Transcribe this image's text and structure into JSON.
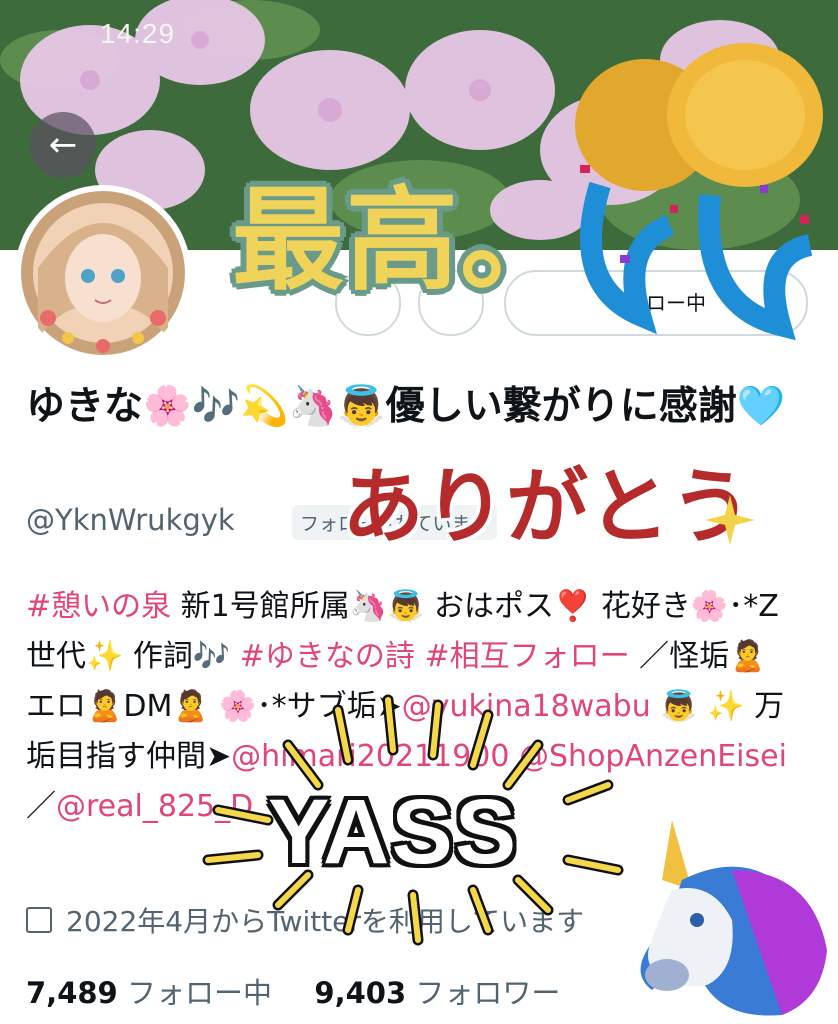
{
  "status_bar": {
    "time": "14:29"
  },
  "header": {
    "back_icon": "arrow-left-icon",
    "back_glyph": "←"
  },
  "actions": {
    "follow_label": "フォロー中"
  },
  "profile": {
    "name": "ゆきな🌸🎶💫🦄👼優しい繋がりに感謝🩵",
    "handle": "@YknWrukgyk",
    "follows_you_badge": "フォローされています",
    "bio": {
      "seg1": "#憩いの泉",
      "seg2": " 新1号館所属🦄👼 おはポス❣️ 花好き🌸･*Z世代✨ 作詞🎶 ",
      "seg3": "#ゆきなの詩",
      "seg4": " ",
      "seg5": "#相互フォロー",
      "seg6": " ／怪垢🙎エロ🙎DM🙎 🌸･*サブ垢➤",
      "seg7": "@yukina18wabu",
      "seg8": " 👼 ✨ 万垢目指す仲間➤",
      "seg9": "@himari20211900",
      "seg10": " ",
      "seg11": "@ShopAnzenEisei",
      "seg12": " ／",
      "seg13": "@real_825_D"
    },
    "joined": "2022年4月からTwitterを利用しています",
    "following_count": "7,489",
    "following_label": " フォロー中",
    "followers_count": "9,403",
    "followers_label": " フォロワー"
  },
  "stickers": {
    "saiko": "最高。",
    "arigato": "ありがとう",
    "yass": "YASS"
  },
  "colors": {
    "hashtag": "#e0457b",
    "secondary_text": "#536471",
    "primary_text": "#0f1419",
    "border": "#cfd9de"
  }
}
